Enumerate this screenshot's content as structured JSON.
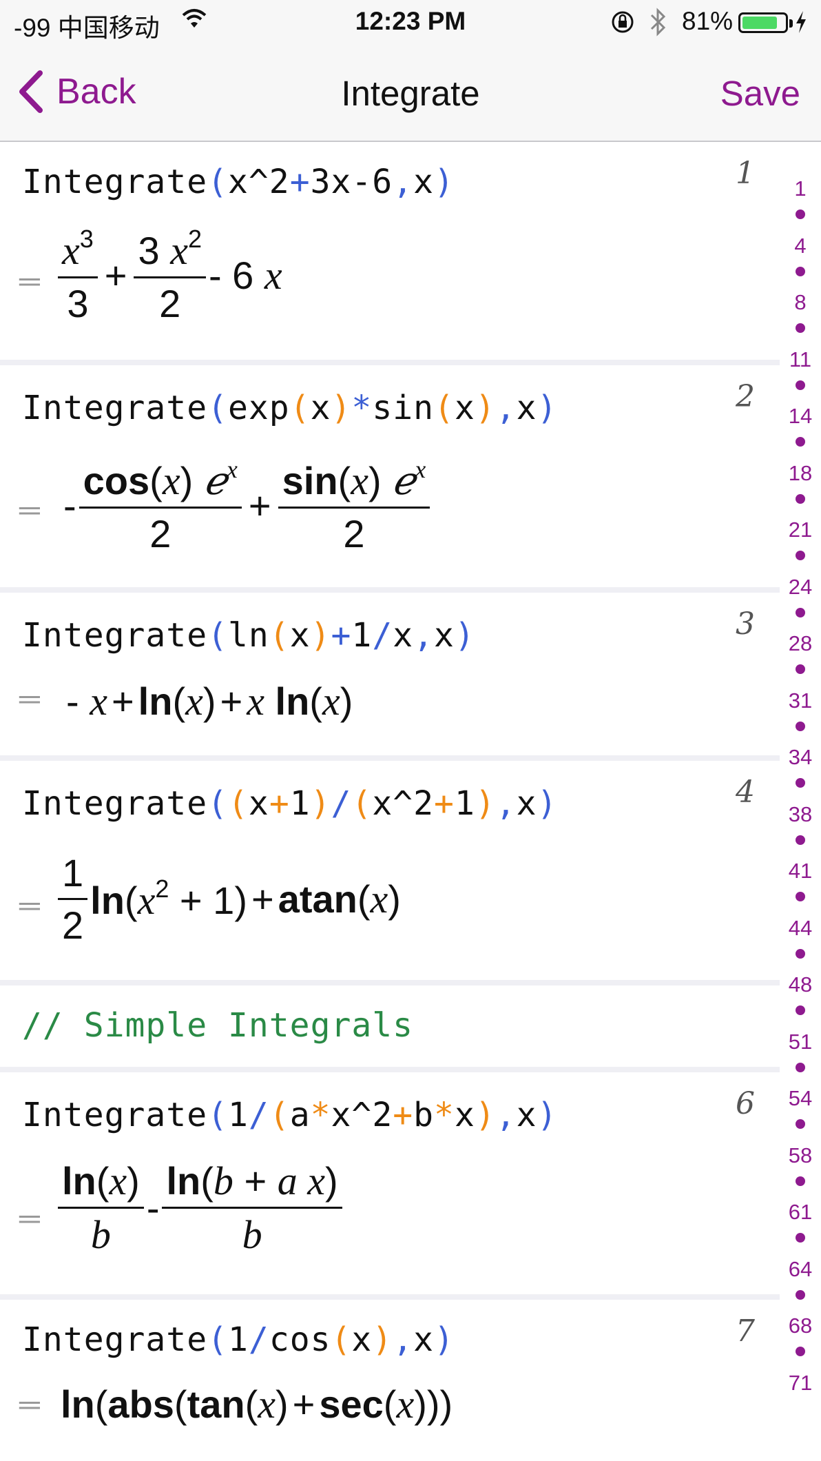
{
  "status": {
    "carrier": "-99 中国移动",
    "time": "12:23 PM",
    "battery_pct": "81%",
    "battery_level": 0.81
  },
  "nav": {
    "back_label": "Back",
    "title": "Integrate",
    "save_label": "Save"
  },
  "cells": [
    {
      "number": "1",
      "input": "Integrate(x^2+3x-6,x)",
      "result": "x^3/3 + 3x^2/2 - 6x"
    },
    {
      "number": "2",
      "input": "Integrate(exp(x)*sin(x),x)",
      "result": "-cos(x)e^x/2 + sin(x)e^x/2"
    },
    {
      "number": "3",
      "input": "Integrate(ln(x)+1/x,x)",
      "result": "-x + ln(x) + x ln(x)"
    },
    {
      "number": "4",
      "input": "Integrate((x+1)/(x^2+1),x)",
      "result": "1/2 ln(x^2 + 1) + atan(x)"
    },
    {
      "comment": "// Simple Integrals"
    },
    {
      "number": "6",
      "input": "Integrate(1/(a*x^2+b*x),x)",
      "result": "ln(x)/b - ln(b + a x)/b"
    },
    {
      "number": "7",
      "input": "Integrate(1/cos(x),x)",
      "result": "ln(abs(tan(x) + sec(x)))"
    }
  ],
  "index_items": [
    "1",
    "4",
    "8",
    "11",
    "14",
    "18",
    "21",
    "24",
    "28",
    "31",
    "34",
    "38",
    "41",
    "44",
    "48",
    "51",
    "54",
    "58",
    "61",
    "64",
    "68",
    "71"
  ],
  "colors": {
    "accent": "#8e1a8f",
    "paren": "#ef8b16",
    "operator": "#3c5fd4",
    "comment": "#2a8a46"
  },
  "math": {
    "c1": {
      "x": "x",
      "three": "3",
      "three_x": "3",
      "two": "2",
      "minus6": "- 6",
      "plus": "+"
    },
    "c2": {
      "minus": "-",
      "cos": "cos",
      "sin": "sin",
      "two": "2",
      "plus": "+"
    },
    "c3": {
      "text_a": "-",
      "text_b": "+",
      "ln": "ln"
    },
    "c4": {
      "one": "1",
      "two": "2",
      "ln": "ln",
      "atan": "atan"
    },
    "c6": {
      "ln": "ln",
      "b": "b"
    },
    "c7": {
      "ln": "ln",
      "abs": "abs",
      "tan": "tan",
      "sec": "sec"
    }
  }
}
